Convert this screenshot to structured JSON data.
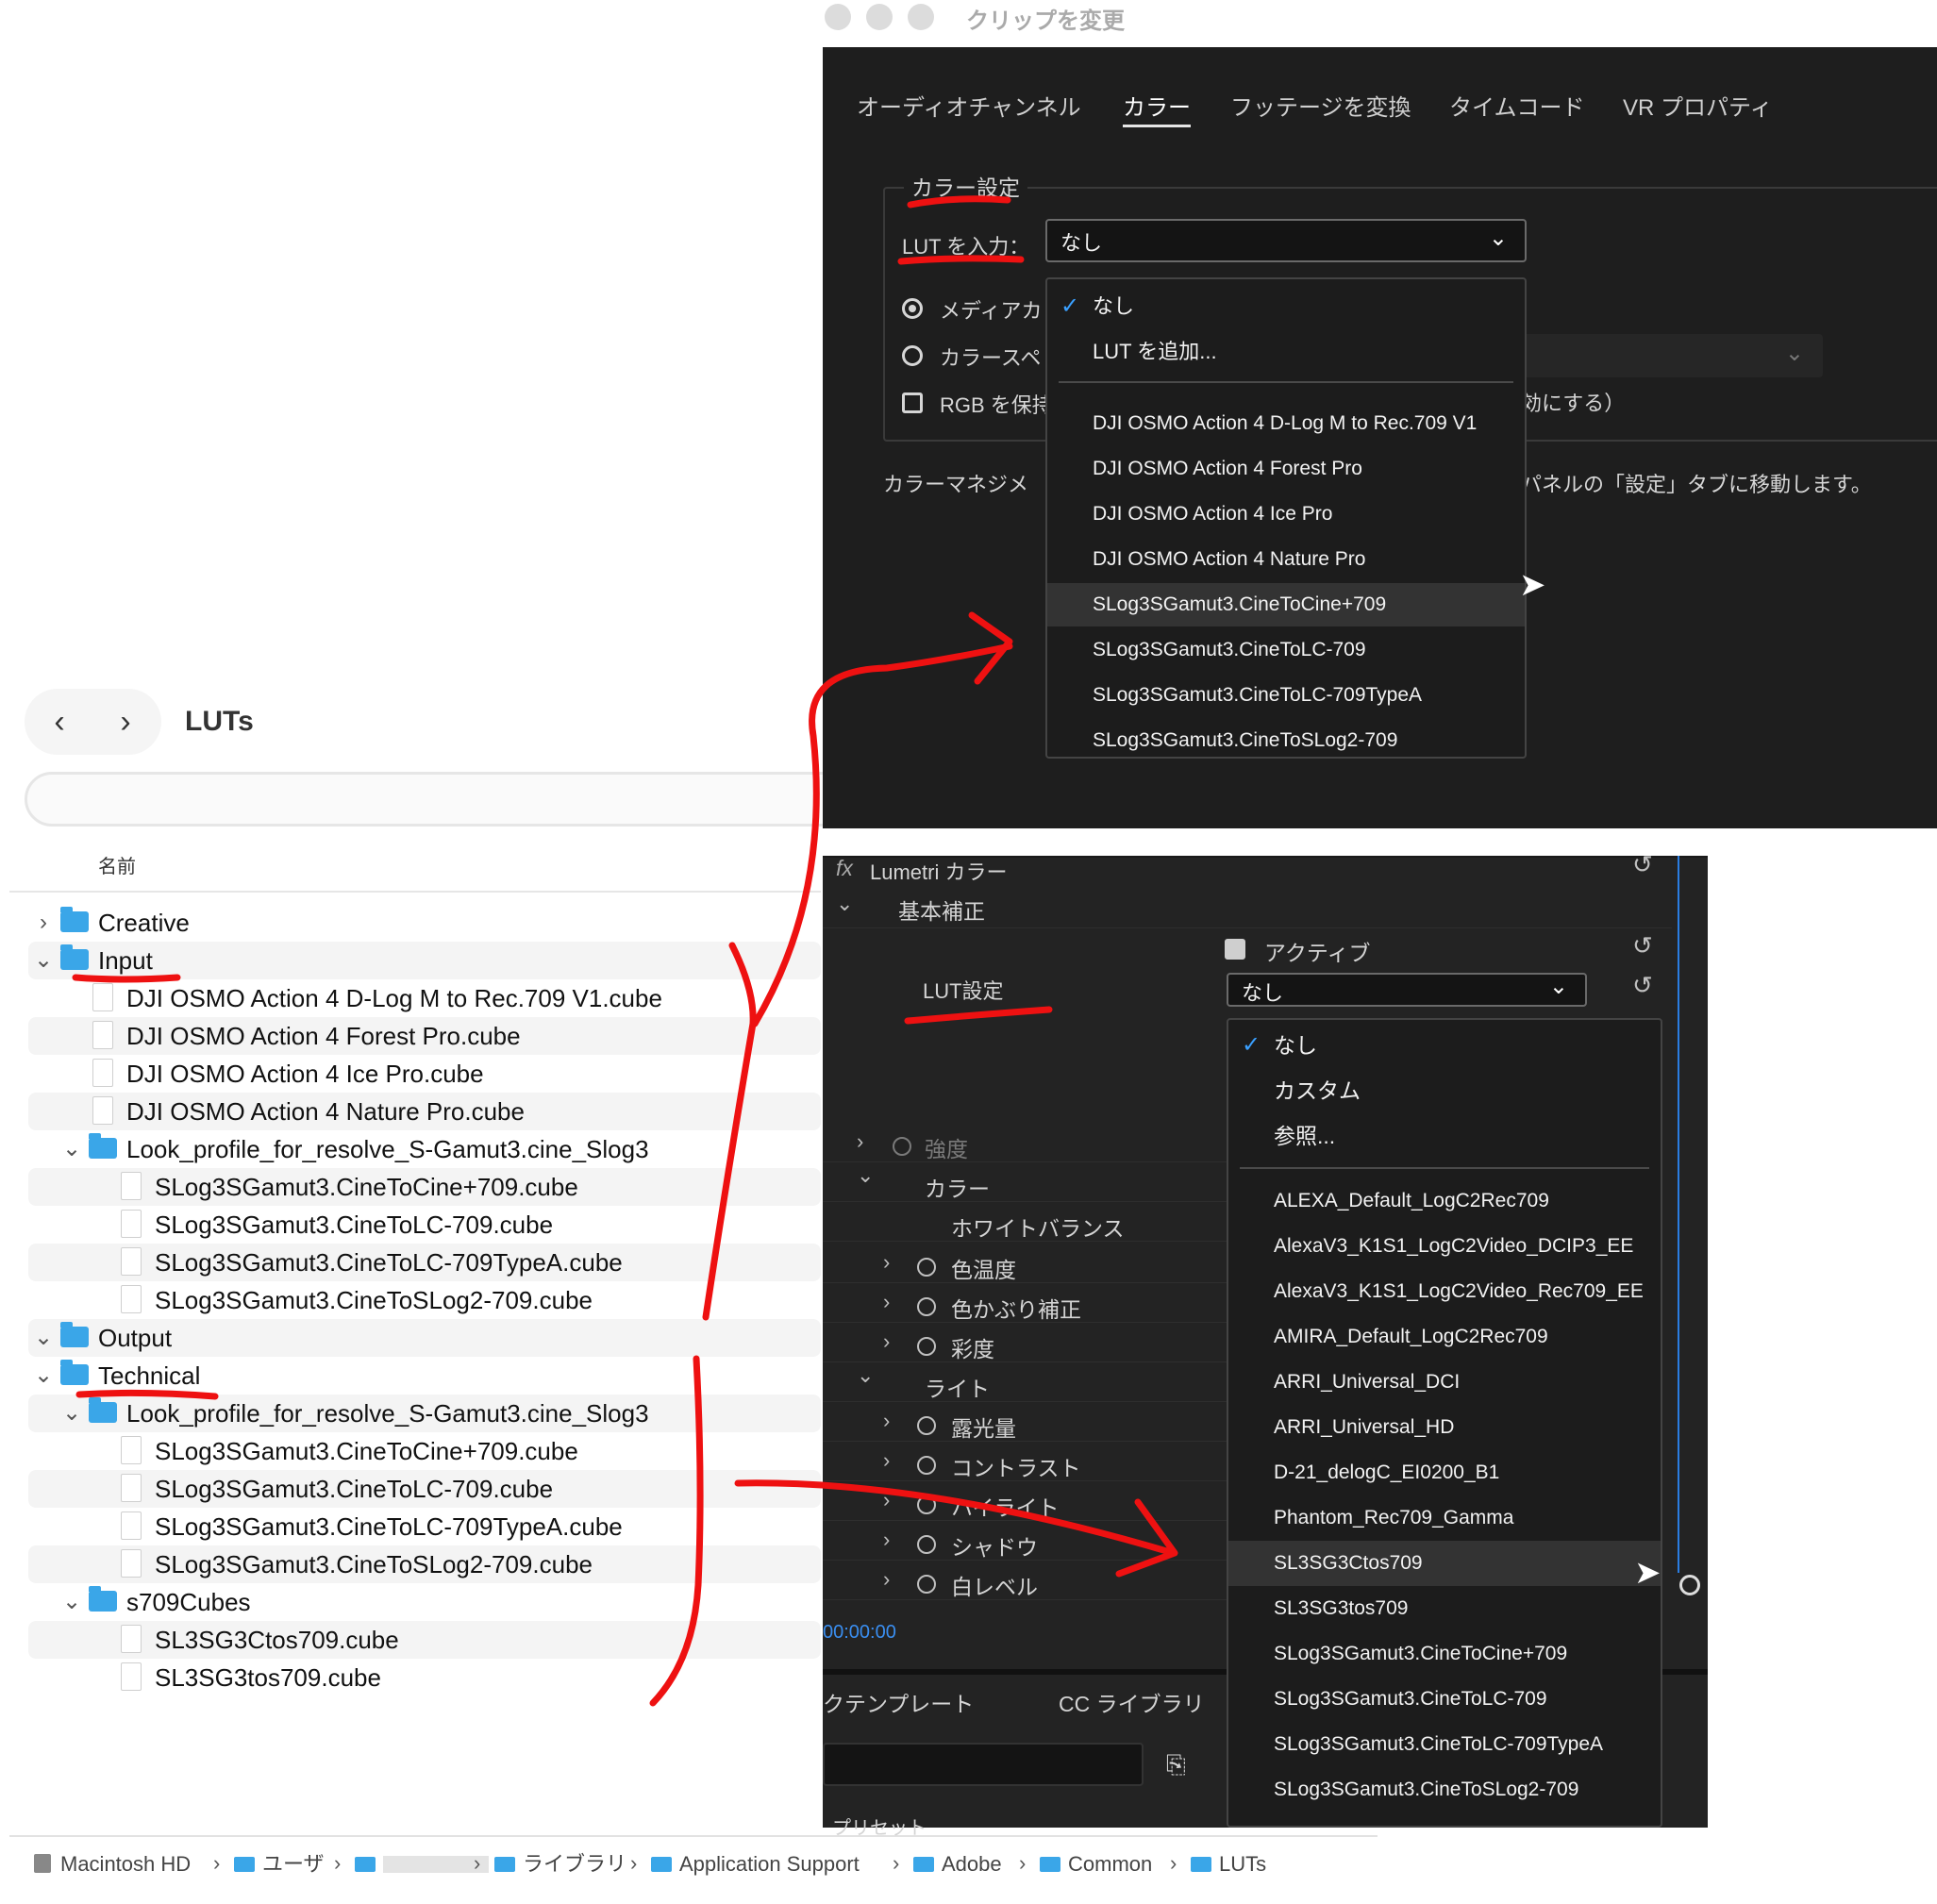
{
  "finder": {
    "title": "LUTs",
    "column_header": "名前",
    "rows": [
      {
        "level": 0,
        "type": "folder",
        "expanded": false,
        "name": "Creative"
      },
      {
        "level": 0,
        "type": "folder",
        "expanded": true,
        "name": "Input"
      },
      {
        "level": 1,
        "type": "file",
        "name": "DJI OSMO Action 4 D-Log M to Rec.709 V1.cube"
      },
      {
        "level": 1,
        "type": "file",
        "name": "DJI OSMO Action 4 Forest Pro.cube"
      },
      {
        "level": 1,
        "type": "file",
        "name": "DJI OSMO Action 4 Ice Pro.cube"
      },
      {
        "level": 1,
        "type": "file",
        "name": "DJI OSMO Action 4 Nature Pro.cube"
      },
      {
        "level": 1,
        "type": "folder",
        "expanded": true,
        "name": "Look_profile_for_resolve_S-Gamut3.cine_Slog3"
      },
      {
        "level": 2,
        "type": "file",
        "name": "SLog3SGamut3.CineToCine+709.cube"
      },
      {
        "level": 2,
        "type": "file",
        "name": "SLog3SGamut3.CineToLC-709.cube"
      },
      {
        "level": 2,
        "type": "file",
        "name": "SLog3SGamut3.CineToLC-709TypeA.cube"
      },
      {
        "level": 2,
        "type": "file",
        "name": "SLog3SGamut3.CineToSLog2-709.cube"
      },
      {
        "level": 0,
        "type": "folder",
        "expanded": true,
        "name": "Output"
      },
      {
        "level": 0,
        "type": "folder",
        "expanded": true,
        "name": "Technical"
      },
      {
        "level": 1,
        "type": "folder",
        "expanded": true,
        "name": "Look_profile_for_resolve_S-Gamut3.cine_Slog3"
      },
      {
        "level": 2,
        "type": "file",
        "name": "SLog3SGamut3.CineToCine+709.cube"
      },
      {
        "level": 2,
        "type": "file",
        "name": "SLog3SGamut3.CineToLC-709.cube"
      },
      {
        "level": 2,
        "type": "file",
        "name": "SLog3SGamut3.CineToLC-709TypeA.cube"
      },
      {
        "level": 2,
        "type": "file",
        "name": "SLog3SGamut3.CineToSLog2-709.cube"
      },
      {
        "level": 1,
        "type": "folder",
        "expanded": true,
        "name": "s709Cubes"
      },
      {
        "level": 2,
        "type": "file",
        "name": "SL3SG3Ctos709.cube"
      },
      {
        "level": 2,
        "type": "file",
        "name": "SL3SG3tos709.cube"
      }
    ],
    "path": [
      "Macintosh HD",
      "ユーザ",
      "",
      "ライブラリ",
      "Application Support",
      "Adobe",
      "Common",
      "LUTs"
    ]
  },
  "clip_dialog": {
    "window_title": "クリップを変更",
    "tabs": [
      "オーディオチャンネル",
      "カラー",
      "フッテージを変換",
      "タイムコード",
      "VR プロパティ"
    ],
    "active_tab": "カラー",
    "group_label": "カラー設定",
    "lut_label": "LUT を入力：",
    "lut_value": "なし",
    "radio_media": "メディアカ",
    "radio_colorspace": "カラースペ",
    "checkbox_rgb": "RGB を保持",
    "behind_text_right": "効にする）",
    "note_left": "カラーマネジメ",
    "note_right": "パネルの「設定」タブに移動します。",
    "menu_checked": "なし",
    "menu_add": "LUT を追加...",
    "menu_items": [
      "DJI OSMO Action 4 D-Log M to Rec.709 V1",
      "DJI OSMO Action 4 Forest Pro",
      "DJI OSMO Action 4 Ice Pro",
      "DJI OSMO Action 4 Nature Pro",
      "SLog3SGamut3.CineToCine+709",
      "SLog3SGamut3.CineToLC-709",
      "SLog3SGamut3.CineToLC-709TypeA",
      "SLog3SGamut3.CineToSLog2-709"
    ],
    "highlighted": "SLog3SGamut3.CineToCine+709"
  },
  "lumetri": {
    "title": "Lumetri カラー",
    "section_basic": "基本補正",
    "active_label": "アクティブ",
    "lut_setting_label": "LUT設定",
    "lut_value": "なし",
    "intensity": "強度",
    "color": "カラー",
    "white_balance": "ホワイトバランス",
    "temperature": "色温度",
    "tint": "色かぶり補正",
    "saturation": "彩度",
    "light": "ライト",
    "exposure": "露光量",
    "contrast": "コントラスト",
    "highlight": "ハイライト",
    "shadow": "シャドウ",
    "white_level": "白レベル",
    "timecode": "00:00:00",
    "bottom_tab_1": "クテンプレート",
    "bottom_tab_2": "CC ライブラリ",
    "preset_label": "プリセット",
    "menu_checked": "なし",
    "menu_custom": "カスタム",
    "menu_browse": "参照...",
    "menu_items": [
      "ALEXA_Default_LogC2Rec709",
      "AlexaV3_K1S1_LogC2Video_DCIP3_EE",
      "AlexaV3_K1S1_LogC2Video_Rec709_EE",
      "AMIRA_Default_LogC2Rec709",
      "ARRI_Universal_DCI",
      "ARRI_Universal_HD",
      "D-21_delogC_EI0200_B1",
      "Phantom_Rec709_Gamma",
      "SL3SG3Ctos709",
      "SL3SG3tos709",
      "SLog3SGamut3.CineToCine+709",
      "SLog3SGamut3.CineToLC-709",
      "SLog3SGamut3.CineToLC-709TypeA",
      "SLog3SGamut3.CineToSLog2-709"
    ],
    "highlighted": "SL3SG3Ctos709"
  },
  "colors": {
    "annotation_red": "#ee1111",
    "checkmark_blue": "#3aa0ff",
    "folder_blue": "#3aa6e8"
  }
}
